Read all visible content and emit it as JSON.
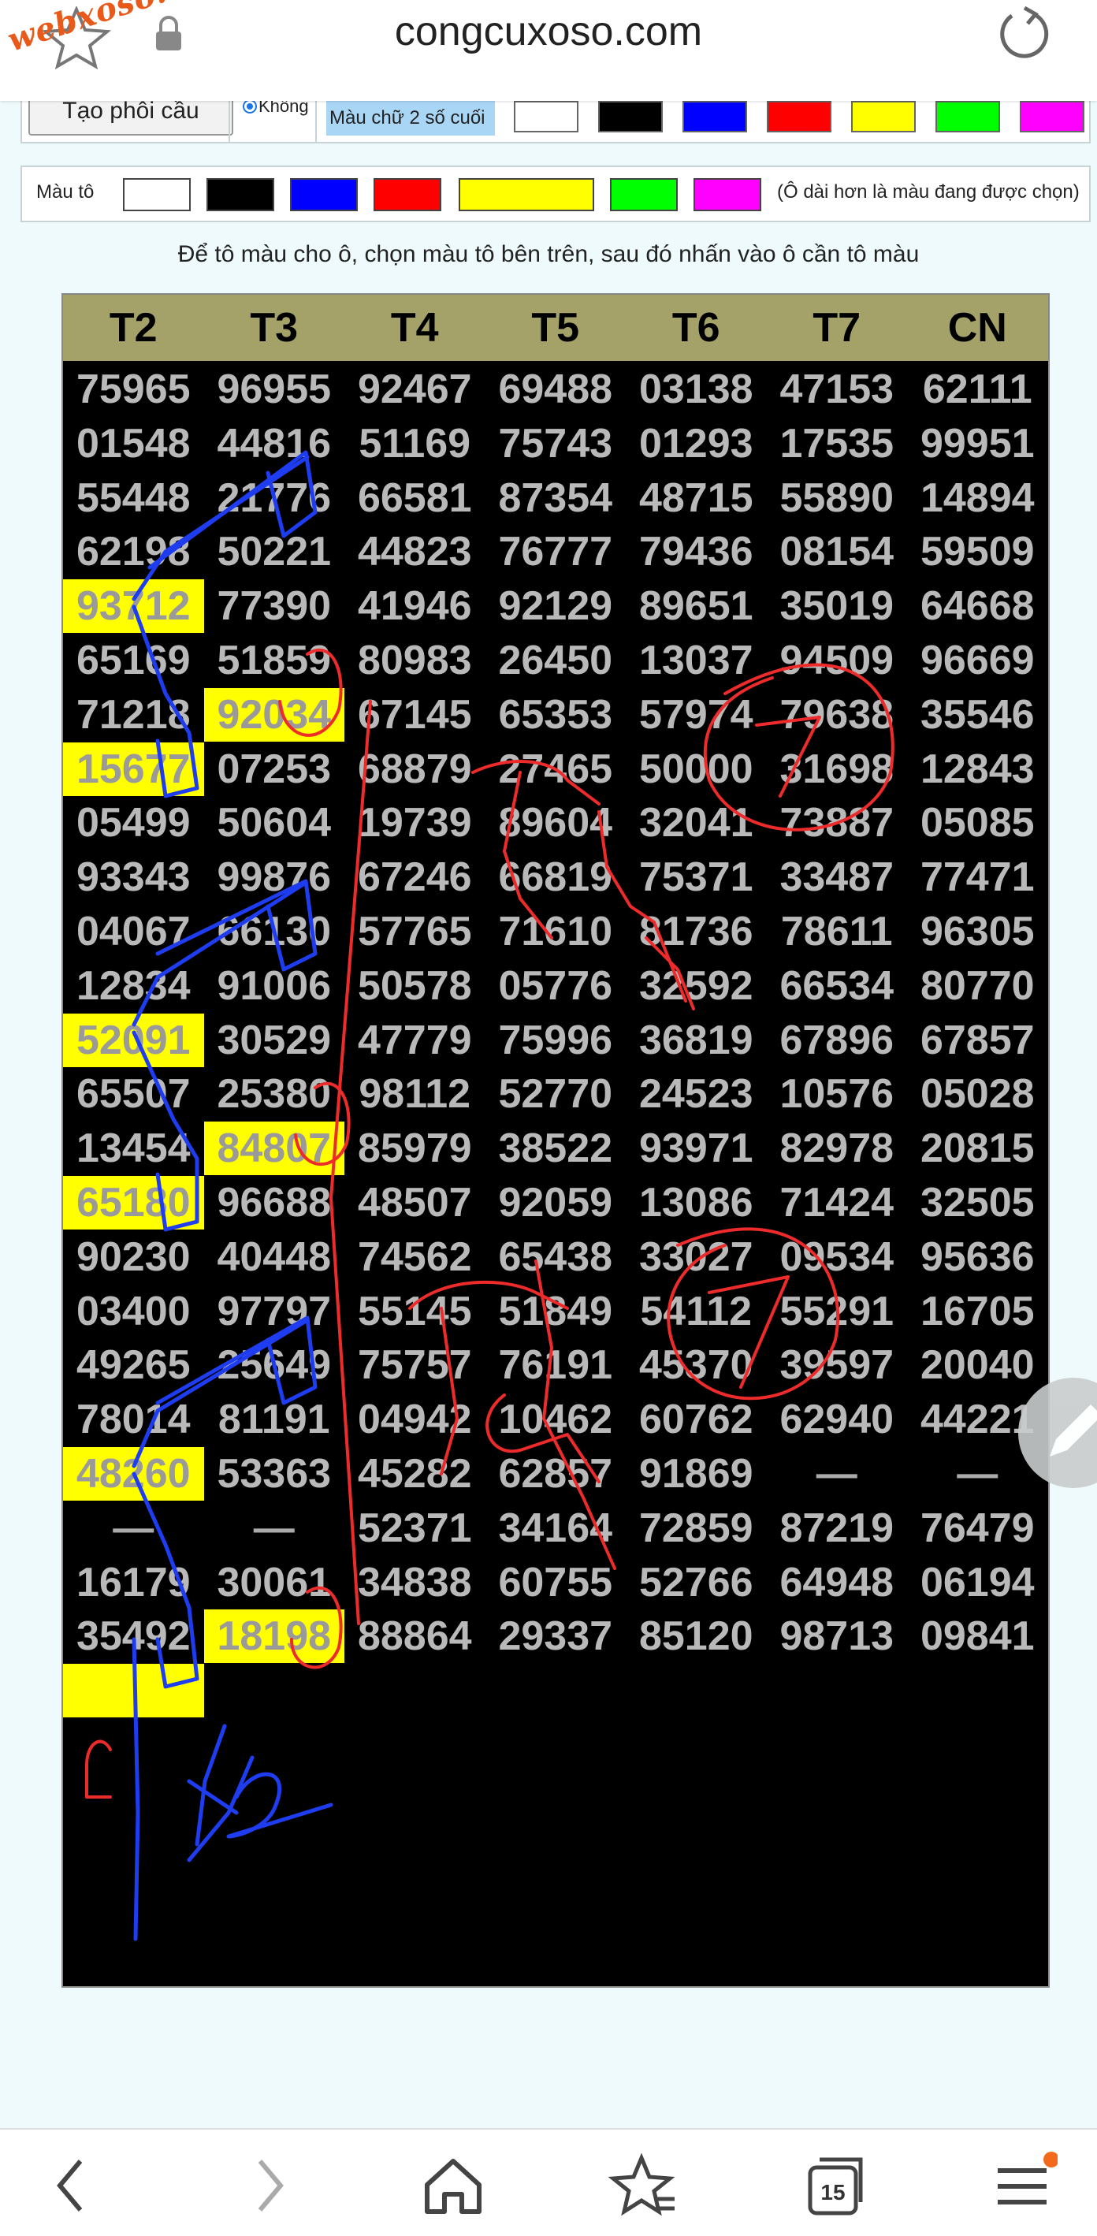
{
  "browser": {
    "url": "congcuxoso.com",
    "watermark": "webxoso.net",
    "tab_count": "15"
  },
  "controls": {
    "tao_phoi_cau": "Tạo phôi cầu",
    "radio_khong": "Không",
    "mau_chu_label": "Màu chữ 2 số cuối",
    "mau_chu_colors": [
      "#ffffff",
      "#000000",
      "#0000ff",
      "#ff0000",
      "#ffff00",
      "#00ff00",
      "#ff00ff"
    ]
  },
  "color_picker": {
    "label": "Màu tô",
    "colors": [
      "#ffffff",
      "#000000",
      "#0000ff",
      "#ff0000",
      "#ffff00",
      "#00ff00",
      "#ff00ff"
    ],
    "selected": "#ffff00",
    "note": "(Ô dài hơn là màu đang được chọn)"
  },
  "instruction": "Để tô màu cho ô, chọn màu tô bên trên, sau đó nhấn vào ô cần tô màu",
  "table": {
    "headers": [
      "T2",
      "T3",
      "T4",
      "T5",
      "T6",
      "T7",
      "CN"
    ],
    "rows": [
      [
        "75965",
        "96955",
        "92467",
        "69488",
        "03138",
        "47153",
        "62111"
      ],
      [
        "01548",
        "44816",
        "51169",
        "75743",
        "01293",
        "17535",
        "99951"
      ],
      [
        "55448",
        "21776",
        "66581",
        "87354",
        "48715",
        "55890",
        "14894"
      ],
      [
        "62198",
        "50221",
        "44823",
        "76777",
        "79436",
        "08154",
        "59509"
      ],
      [
        "93712",
        "77390",
        "41946",
        "92129",
        "89651",
        "35019",
        "64668"
      ],
      [
        "65169",
        "51859",
        "80983",
        "26450",
        "13037",
        "94509",
        "96669"
      ],
      [
        "71218",
        "92034",
        "67145",
        "65353",
        "57974",
        "79638",
        "35546"
      ],
      [
        "15677",
        "07253",
        "68879",
        "27465",
        "50000",
        "31698",
        "12843"
      ],
      [
        "05499",
        "50604",
        "19739",
        "89604",
        "32041",
        "73887",
        "05085"
      ],
      [
        "93343",
        "99876",
        "67246",
        "66819",
        "75371",
        "33487",
        "77471"
      ],
      [
        "04067",
        "66130",
        "57765",
        "71610",
        "81736",
        "78611",
        "96305"
      ],
      [
        "12834",
        "91006",
        "50578",
        "05776",
        "32592",
        "66534",
        "80770"
      ],
      [
        "52091",
        "30529",
        "47779",
        "75996",
        "36819",
        "67896",
        "67857"
      ],
      [
        "65507",
        "25380",
        "98112",
        "52770",
        "24523",
        "10576",
        "05028"
      ],
      [
        "13454",
        "84807",
        "85979",
        "38522",
        "93971",
        "82978",
        "20815"
      ],
      [
        "65180",
        "96688",
        "48507",
        "92059",
        "13086",
        "71424",
        "32505"
      ],
      [
        "90230",
        "40448",
        "74562",
        "65438",
        "33027",
        "09534",
        "95636"
      ],
      [
        "03400",
        "97797",
        "55145",
        "51849",
        "54112",
        "55291",
        "16705"
      ],
      [
        "49265",
        "25649",
        "75757",
        "76191",
        "45370",
        "39597",
        "20040"
      ],
      [
        "78014",
        "81191",
        "04942",
        "10462",
        "60762",
        "62940",
        "44221"
      ],
      [
        "48260",
        "53363",
        "45282",
        "62857",
        "91869",
        "—",
        "—"
      ],
      [
        "—",
        "—",
        "52371",
        "34164",
        "72859",
        "87219",
        "76479"
      ],
      [
        "16179",
        "30061",
        "34838",
        "60755",
        "52766",
        "64948",
        "06194"
      ],
      [
        "35492",
        "18198",
        "88864",
        "29337",
        "85120",
        "98713",
        "09841"
      ],
      [
        "",
        "",
        "",
        "",
        "",
        "",
        ""
      ]
    ],
    "highlighted": [
      [
        4,
        0
      ],
      [
        6,
        1
      ],
      [
        7,
        0
      ],
      [
        12,
        0
      ],
      [
        14,
        1
      ],
      [
        15,
        0
      ],
      [
        20,
        0
      ],
      [
        23,
        1
      ],
      [
        24,
        0
      ]
    ]
  },
  "annotations": {
    "handwriting_1": "2",
    "handwriting_2": "24",
    "handwriting_3": "42"
  }
}
